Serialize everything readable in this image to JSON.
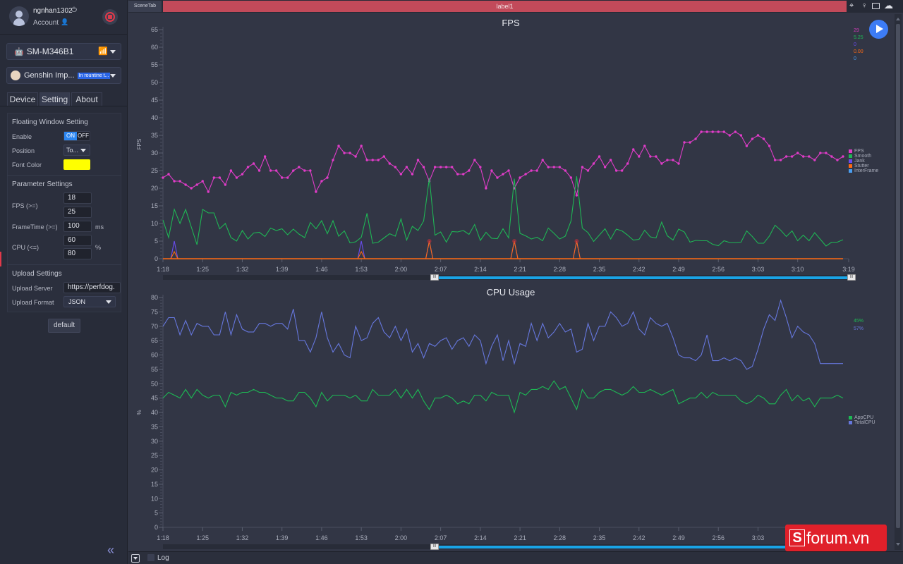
{
  "user": {
    "name": "ngnhan1302",
    "account_label": "Account"
  },
  "device": {
    "name": "SM-M346B1"
  },
  "app": {
    "name": "Genshin Imp...",
    "status_badge": "In rountine t..."
  },
  "tabs": [
    {
      "label": "Device"
    },
    {
      "label": "Setting",
      "active": true
    },
    {
      "label": "About"
    }
  ],
  "floating_window": {
    "title": "Floating Window Setting",
    "enable_label": "Enable",
    "toggle_on": "ON",
    "toggle_off": "OFF",
    "enabled": true,
    "position_label": "Position",
    "position_value": "To...",
    "font_color_label": "Font Color",
    "font_color": "#ffff00"
  },
  "parameters": {
    "title": "Parameter Settings",
    "fps_label": "FPS (>=)",
    "fps_value_1": "18",
    "fps_value_2": "25",
    "frametime_label": "FrameTime (>=)",
    "frametime_value": "100",
    "frametime_unit": "ms",
    "cpu_label": "CPU (<=)",
    "cpu_value_1": "60",
    "cpu_value_2": "80",
    "cpu_unit": "%"
  },
  "upload": {
    "title": "Upload Settings",
    "server_label": "Upload Server",
    "server_value": "https://perfdog.",
    "format_label": "Upload Format",
    "format_value": "JSON"
  },
  "default_button": "default",
  "topbar": {
    "scene_tab": "SceneTab",
    "label": "label1",
    "label_color": "#c24a5a"
  },
  "bottom": {
    "log_label": "Log",
    "log_checked": false
  },
  "watermark": "forum.vn",
  "chart_data": [
    {
      "type": "line",
      "title": "FPS",
      "ylabel": "FPS",
      "ylim": [
        0,
        65
      ],
      "yticks": [
        0,
        5,
        10,
        15,
        20,
        25,
        30,
        35,
        40,
        45,
        50,
        55,
        60,
        65
      ],
      "xlim": [
        "1:18",
        "3:19"
      ],
      "xticks": [
        "1:18",
        "1:25",
        "1:32",
        "1:39",
        "1:46",
        "1:53",
        "2:00",
        "2:07",
        "2:14",
        "2:21",
        "2:28",
        "2:35",
        "2:42",
        "2:49",
        "2:56",
        "3:03",
        "3:10",
        "3:19"
      ],
      "x_start": "1:18",
      "x_step_seconds": 1,
      "legend_position": "right",
      "current_values": [
        "29",
        "5.25",
        "0",
        "0.00",
        "0"
      ],
      "series": [
        {
          "name": "FPS",
          "color": "#e03cc8",
          "markers": true,
          "values": [
            23,
            24,
            22,
            22,
            21,
            20,
            21,
            22,
            19,
            23,
            23,
            21,
            25,
            23,
            24,
            26,
            27,
            25,
            29,
            25,
            25,
            23,
            23,
            25,
            26,
            25,
            25,
            19,
            22,
            23,
            28,
            32,
            30,
            30,
            29,
            32,
            28,
            28,
            28,
            29,
            27,
            26,
            24,
            26,
            24,
            28,
            26,
            22,
            26,
            26,
            26,
            26,
            24,
            24,
            25,
            28,
            26,
            20,
            25,
            23,
            24,
            25,
            20,
            23,
            24,
            25,
            25,
            28,
            26,
            26,
            26,
            25,
            23,
            18,
            26,
            25,
            27,
            29,
            26,
            28,
            25,
            25,
            27,
            31,
            29,
            32,
            29,
            29,
            27,
            28,
            28,
            27,
            33,
            33,
            34,
            36,
            36,
            36,
            36,
            36,
            35,
            36,
            35,
            32,
            34,
            35,
            34,
            32,
            28,
            28,
            29,
            29,
            30,
            29,
            29,
            28,
            30,
            30,
            29,
            28,
            29
          ]
        },
        {
          "name": "Smooth",
          "color": "#1fb655",
          "values": [
            11,
            6,
            14,
            10,
            14,
            9,
            4,
            14,
            13,
            13,
            8.5,
            10,
            6,
            5,
            8,
            5.6,
            7.3,
            7.5,
            6.3,
            8.7,
            8,
            8.5,
            6.8,
            8.4,
            7,
            6,
            10.3,
            8.5,
            10.8,
            7.1,
            10.8,
            6.4,
            7.9,
            4.5,
            4.8,
            6.1,
            12.9,
            4.4,
            4.7,
            5.9,
            7.1,
            6.4,
            11.3,
            5.3,
            9.2,
            8,
            10.7,
            22.9,
            6.7,
            7.6,
            4.7,
            7.7,
            7.6,
            8,
            6.9,
            9.7,
            5.2,
            7.5,
            5.8,
            5.7,
            8.5,
            5.9,
            22.7,
            7.2,
            6.5,
            5.6,
            6.1,
            5.1,
            8.7,
            7.2,
            5.6,
            6.4,
            10.7,
            23.4,
            8.7,
            7.4,
            4.9,
            6.7,
            8.5,
            5.6,
            8.4,
            7.9,
            6.7,
            5.3,
            5.5,
            8.1,
            6.2,
            5.9,
            10.4,
            6.5,
            5.3,
            8.4,
            7.6,
            4.7,
            5.2,
            5.1,
            5.1,
            4.1,
            3.7,
            5.1,
            4.6,
            4.6,
            4.7,
            7.9,
            6.3,
            4.4,
            4.4,
            6.4,
            9.5,
            8.1,
            6.3,
            7.9,
            5.1,
            6.7,
            5.1,
            7.4,
            5.5,
            3.6,
            4.7,
            4.7,
            5.4
          ]
        },
        {
          "name": "Jank",
          "color": "#6a4cf0",
          "events": [
            {
              "t": "1:20",
              "v": 5
            },
            {
              "t": "1:53",
              "v": 5
            },
            {
              "t": "2:05",
              "v": 5
            },
            {
              "t": "2:20",
              "v": 5
            },
            {
              "t": "2:31",
              "v": 5
            }
          ]
        },
        {
          "name": "Stutter",
          "color": "#ff6a13",
          "events": [
            {
              "t": "1:20",
              "v": 2
            },
            {
              "t": "1:53",
              "v": 2
            },
            {
              "t": "2:05",
              "v": 5
            },
            {
              "t": "2:20",
              "v": 5
            },
            {
              "t": "2:31",
              "v": 5
            }
          ]
        },
        {
          "name": "InterFrame",
          "color": "#4a9ef0",
          "values_constant": 0
        }
      ]
    },
    {
      "type": "line",
      "title": "CPU Usage",
      "ylabel": "%",
      "ylim": [
        0,
        80
      ],
      "yticks": [
        0,
        5,
        10,
        15,
        20,
        25,
        30,
        35,
        40,
        45,
        50,
        55,
        60,
        65,
        70,
        75,
        80
      ],
      "xlim": [
        "1:18",
        "3:19"
      ],
      "xticks": [
        "1:18",
        "1:25",
        "1:32",
        "1:39",
        "1:46",
        "1:53",
        "2:00",
        "2:07",
        "2:14",
        "2:21",
        "2:28",
        "2:35",
        "2:42",
        "2:49",
        "2:56",
        "3:03",
        "3:10"
      ],
      "x_start": "1:18",
      "x_step_seconds": 1,
      "legend_position": "right",
      "current_values": [
        "45%",
        "57%"
      ],
      "series": [
        {
          "name": "AppCPU",
          "color": "#1db954",
          "values": [
            45,
            47,
            46,
            45,
            48,
            45,
            48,
            46,
            45,
            46,
            46,
            42,
            47,
            46,
            47,
            47,
            48,
            47,
            47,
            46,
            45,
            45,
            44,
            44,
            47,
            47,
            45,
            42,
            47,
            44,
            46,
            46,
            46,
            45,
            46,
            44,
            44,
            48,
            46,
            46,
            46,
            48,
            45,
            48,
            45,
            48,
            44,
            41,
            45,
            45,
            46,
            45,
            43,
            44,
            43,
            46,
            46,
            44,
            47,
            46,
            46,
            46,
            40,
            47,
            46,
            48,
            48,
            49,
            48,
            51,
            48,
            49,
            45,
            41,
            48,
            45,
            45,
            47,
            48,
            48,
            47,
            46,
            47,
            49,
            47,
            47,
            48,
            47,
            46,
            47,
            48,
            43,
            44,
            45,
            45,
            47,
            45,
            47,
            46,
            46,
            46,
            46,
            44,
            43,
            44,
            46,
            45,
            43,
            43,
            46,
            48,
            44,
            46,
            44,
            45,
            42,
            45,
            45,
            45,
            46,
            45
          ]
        },
        {
          "name": "TotalCPU",
          "color": "#6677dd",
          "values": [
            70,
            73,
            73,
            67,
            72,
            67,
            71,
            70,
            70,
            67,
            67,
            75,
            67,
            74,
            69,
            68,
            68,
            71,
            71,
            70,
            71,
            71,
            69,
            76,
            65,
            65,
            61,
            66,
            75,
            66,
            61,
            64,
            60,
            59,
            70,
            65,
            66,
            71,
            73,
            68,
            66,
            70,
            65,
            69,
            61,
            64,
            59,
            64,
            63,
            65,
            66,
            62,
            65,
            66,
            63,
            67,
            65,
            57,
            63,
            67,
            58,
            65,
            57,
            64,
            63,
            71,
            65,
            71,
            66,
            68,
            71,
            68,
            69,
            61,
            62,
            71,
            65,
            70,
            70,
            75,
            73,
            70,
            71,
            75,
            69,
            67,
            73,
            71,
            70,
            71,
            66,
            60,
            59,
            59,
            58,
            60,
            67,
            58,
            58,
            59,
            58,
            59,
            58,
            55,
            56,
            62,
            69,
            74,
            72,
            79,
            73,
            66,
            70,
            68,
            67,
            64,
            57,
            57,
            57,
            57,
            57
          ]
        }
      ]
    }
  ]
}
